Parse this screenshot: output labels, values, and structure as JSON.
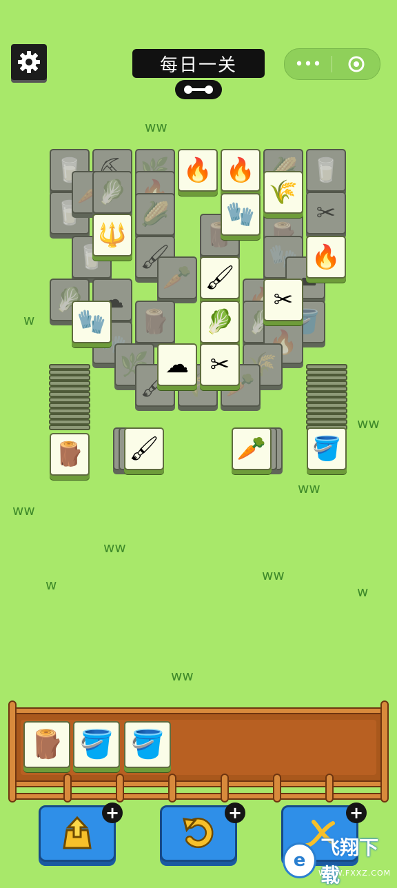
{
  "header": {
    "title": "每日一关",
    "capsule_more": "•••"
  },
  "colors": {
    "background": "#a8e86a",
    "tile_face": "#fbfde8",
    "tile_back": "#8e9a78",
    "tray_wood": "#a9581c",
    "button_blue": "#2f8fe8"
  },
  "board": {
    "front_tiles": [
      "campfire",
      "campfire",
      "wheat-bundle",
      "glove",
      "rake",
      "campfire",
      "brush",
      "shears",
      "cabbage",
      "glove",
      "cotton",
      "shears"
    ],
    "back_tiles": [
      "milk-can",
      "shovel",
      "plant",
      "corn",
      "milk-can",
      "carrot",
      "cabbage",
      "campfire",
      "wheat-bundle",
      "corn",
      "rake",
      "brush",
      "cotton",
      "stump",
      "campfire",
      "bucket"
    ]
  },
  "side_stacks": {
    "left_top": "stump",
    "left_mid": "brush",
    "right_mid": "carrot",
    "right_top": "bucket"
  },
  "tray": {
    "slots": [
      "stump",
      "bucket",
      "bucket"
    ]
  },
  "powerups": [
    {
      "name": "move-out",
      "icon": "box-arrow-up-icon"
    },
    {
      "name": "undo",
      "icon": "undo-icon"
    },
    {
      "name": "shuffle",
      "icon": "shuffle-icon"
    }
  ],
  "watermark": {
    "text": "飞翔下载",
    "url": "WWW.FXXZ.COM"
  },
  "icons": {
    "campfire": "🔥",
    "wheat-bundle": "🌾",
    "glove": "🧤",
    "rake": "🔱",
    "brush": "🖌",
    "shears": "✂",
    "cabbage": "🥬",
    "cotton": "☁",
    "stump": "🪵",
    "bucket": "🪣",
    "carrot": "🥕",
    "corn": "🌽",
    "milk-can": "🥛",
    "shovel": "⛏",
    "plant": "🌿"
  }
}
